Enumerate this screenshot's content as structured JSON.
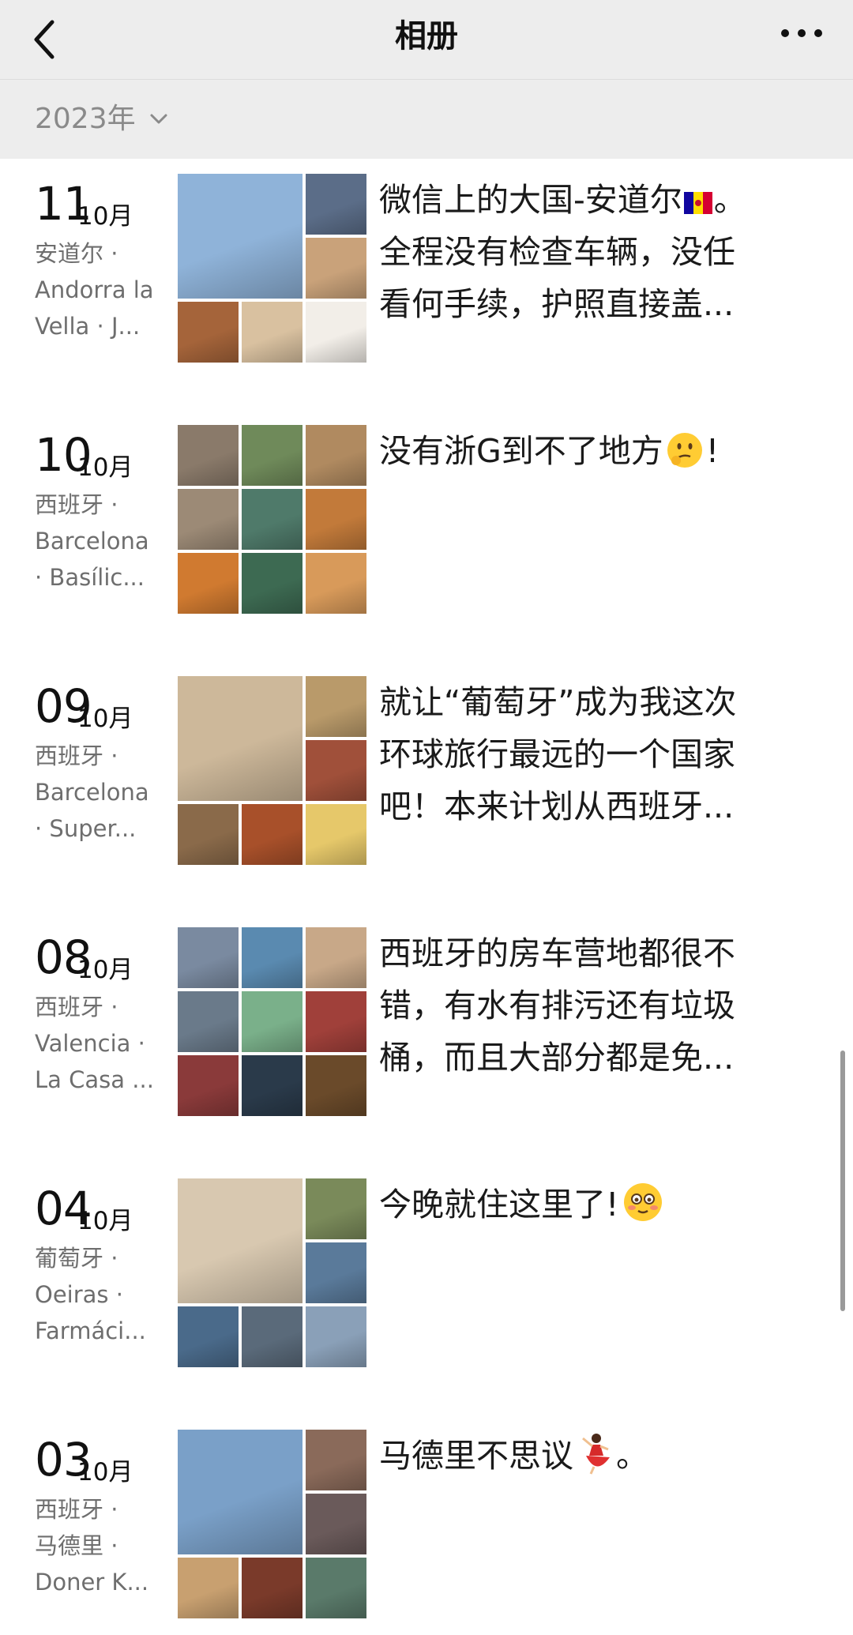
{
  "header": {
    "title": "相册",
    "back_icon": "chevron-left-icon",
    "more_icon": "more-dots-icon"
  },
  "year_filter": {
    "label": "2023年"
  },
  "entries": [
    {
      "day": "11",
      "month": "10月",
      "location": [
        "安道尔 ·",
        "Andorra la",
        "Vella · J..."
      ],
      "caption": [
        "微信上的大国-安道尔",
        "。",
        "全程没有检查车辆，没任",
        "看何手续，护照直接盖..."
      ]
    },
    {
      "day": "10",
      "month": "10月",
      "location": [
        "西班牙 ·",
        "Barcelona",
        "· Basílic..."
      ],
      "caption": [
        "没有浙G到不了地方",
        "!"
      ]
    },
    {
      "day": "09",
      "month": "10月",
      "location": [
        "西班牙 ·",
        "Barcelona",
        "· Super..."
      ],
      "caption": [
        "就让“葡萄牙”成为我这次",
        "环球旅行最远的一个国家",
        "吧！本来计划从西班牙..."
      ]
    },
    {
      "day": "08",
      "month": "10月",
      "location": [
        "西班牙 ·",
        "Valencia ·",
        "La Casa ..."
      ],
      "caption": [
        "西班牙的房车营地都很不",
        "错，有水有排污还有垃圾",
        "桶，而且大部分都是免..."
      ]
    },
    {
      "day": "04",
      "month": "10月",
      "location": [
        "葡萄牙 ·",
        "Oeiras ·",
        "Farmáci..."
      ],
      "caption": [
        "今晚就住这里了!"
      ]
    },
    {
      "day": "03",
      "month": "10月",
      "location": [
        "西班牙 ·",
        "马德里 ·",
        "Doner K..."
      ],
      "caption": [
        "马德里不思议",
        "。"
      ]
    }
  ],
  "colors": {
    "nav_bg": "#ededed",
    "year_text": "#8a8a8a",
    "location_text": "#6e6e6e",
    "caption_text": "#1a1a1a"
  }
}
